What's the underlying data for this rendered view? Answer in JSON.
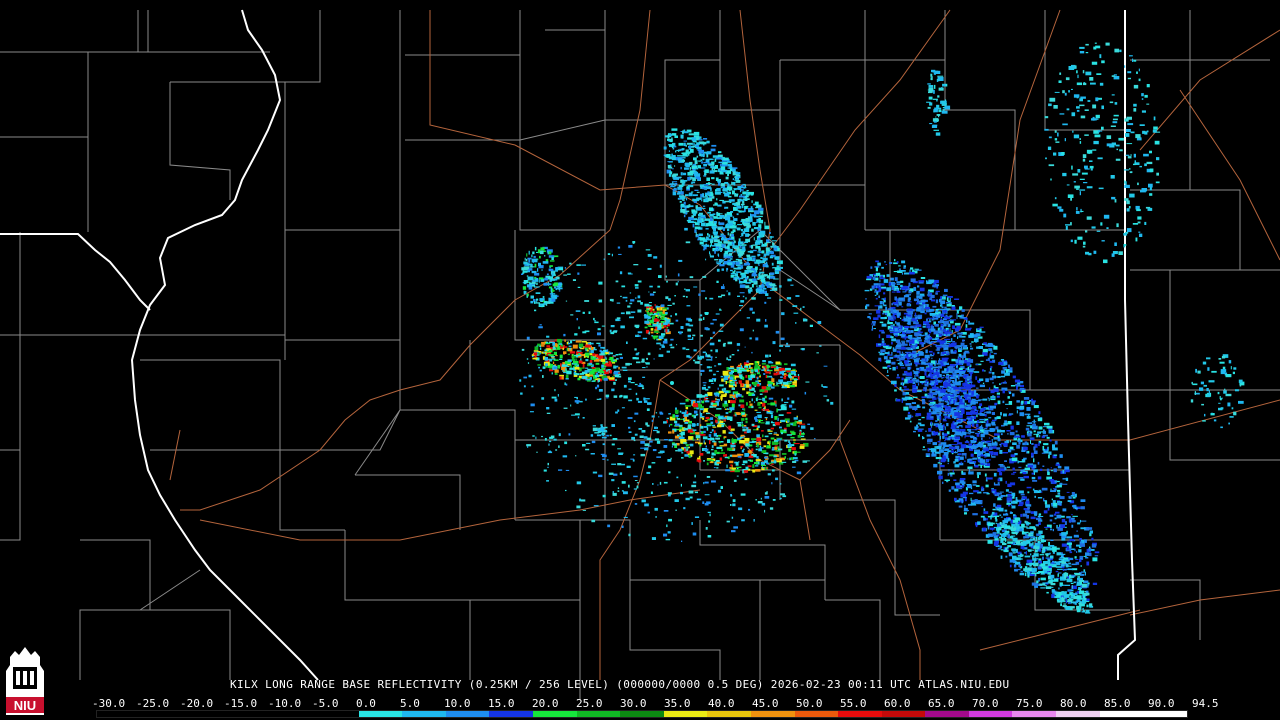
{
  "caption": {
    "site": "KILX",
    "product": "LONG RANGE BASE REFLECTIVITY",
    "resolution": "(0.25KM / 256 LEVEL)",
    "scan": "(000000/0000 0.5 DEG)",
    "timestamp": "2026-02-23 00:11 UTC",
    "source": "ATLAS.NIU.EDU"
  },
  "logo": {
    "text": "NIU",
    "icon": "niu-altgeld-tower-icon"
  },
  "scale": {
    "labels": [
      "-30.0",
      "-25.0",
      "-20.0",
      "-15.0",
      "-10.0",
      "-5.0",
      "0.0",
      "5.0",
      "10.0",
      "15.0",
      "20.0",
      "25.0",
      "30.0",
      "35.0",
      "40.0",
      "45.0",
      "50.0",
      "55.0",
      "60.0",
      "65.0",
      "70.0",
      "75.0",
      "80.0",
      "85.0",
      "90.0",
      "94.5"
    ],
    "colors": [
      "#000000",
      "#000000",
      "#000000",
      "#000000",
      "#000000",
      "#000000",
      "#29e3e3",
      "#1fb8f0",
      "#1e8df0",
      "#1535e5",
      "#16e63c",
      "#10b824",
      "#0c8a12",
      "#eaea14",
      "#e8c50c",
      "#f0920f",
      "#ec5a0c",
      "#e60c0c",
      "#c40a0a",
      "#a30a8c",
      "#d23be0",
      "#e888ee",
      "#f0d0f2",
      "#ffffff",
      "#ffffff"
    ]
  },
  "colors": {
    "state_border": "#ffffff",
    "county_border": "#8c8c8c",
    "highway": "#b4643c",
    "background": "#000000"
  }
}
